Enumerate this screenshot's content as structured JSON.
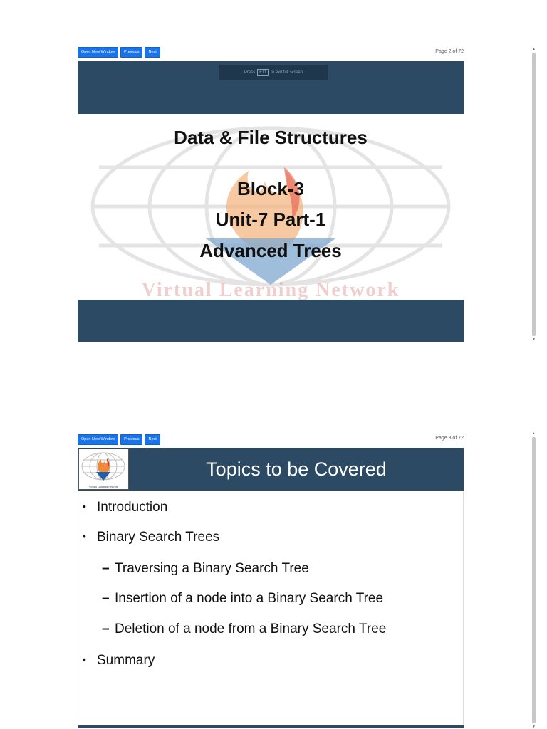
{
  "viewer_1": {
    "toolbar": {
      "open_new_window": "Open New Window",
      "previous": "Previous",
      "next": "Next"
    },
    "page_indicator": "Page 2 of 72",
    "fullscreen_hint": {
      "press": "Press",
      "key": "F11",
      "rest": "to exit full screen"
    },
    "slide": {
      "title": "Data & File Structures",
      "lines": [
        "Block-3",
        "Unit-7 Part-1",
        "Advanced Trees"
      ],
      "watermark": "Virtual Learning Network"
    }
  },
  "viewer_2": {
    "toolbar": {
      "open_new_window": "Open New Window",
      "previous": "Previous",
      "next": "Next"
    },
    "page_indicator": "Page 3 of 72",
    "slide": {
      "logo_caption": "Virtual Learning Network",
      "title": "Topics to be Covered",
      "bullets": [
        {
          "level": 1,
          "marker": "•",
          "text": "Introduction"
        },
        {
          "level": 1,
          "marker": "•",
          "text": "Binary Search Trees"
        },
        {
          "level": 2,
          "marker": "–",
          "text": "Traversing a Binary Search Tree"
        },
        {
          "level": 2,
          "marker": "–",
          "text": "Insertion of a node into a Binary Search Tree"
        },
        {
          "level": 2,
          "marker": "–",
          "text": "Deletion of a node from a Binary Search Tree"
        },
        {
          "level": 1,
          "marker": "•",
          "text": "Summary"
        }
      ]
    }
  },
  "colors": {
    "slide_band": "#2c4a63",
    "button": "#1a73e8"
  }
}
